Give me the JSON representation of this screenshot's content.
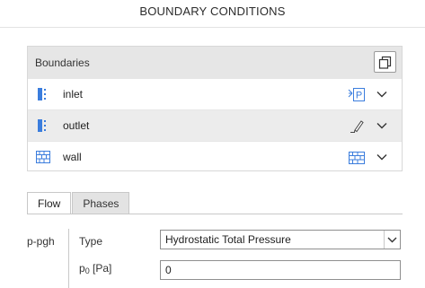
{
  "panel": {
    "title": "BOUNDARY CONDITIONS"
  },
  "boundaries": {
    "header": "Boundaries",
    "copy_icon": "copy-icon",
    "items": [
      {
        "label": "inlet",
        "icon": "patch-icon",
        "type_icon": "pressure-inlet-icon",
        "type_text": "P"
      },
      {
        "label": "outlet",
        "icon": "patch-icon",
        "type_icon": "pencil-icon"
      },
      {
        "label": "wall",
        "icon": "wall-icon",
        "type_icon": "wall-icon"
      }
    ]
  },
  "tabs": [
    {
      "label": "Flow",
      "active": true
    },
    {
      "label": "Phases",
      "active": false
    }
  ],
  "flow": {
    "group": "p-pgh",
    "type_label": "Type",
    "type_value": "Hydrostatic Total Pressure",
    "p0_label": "p",
    "p0_sub": "0",
    "p0_unit": "[Pa]",
    "p0_value": "0"
  },
  "colors": {
    "accent": "#2f6fd1",
    "header_bg": "#e6e6e6",
    "alt_row_bg": "#ececec"
  }
}
